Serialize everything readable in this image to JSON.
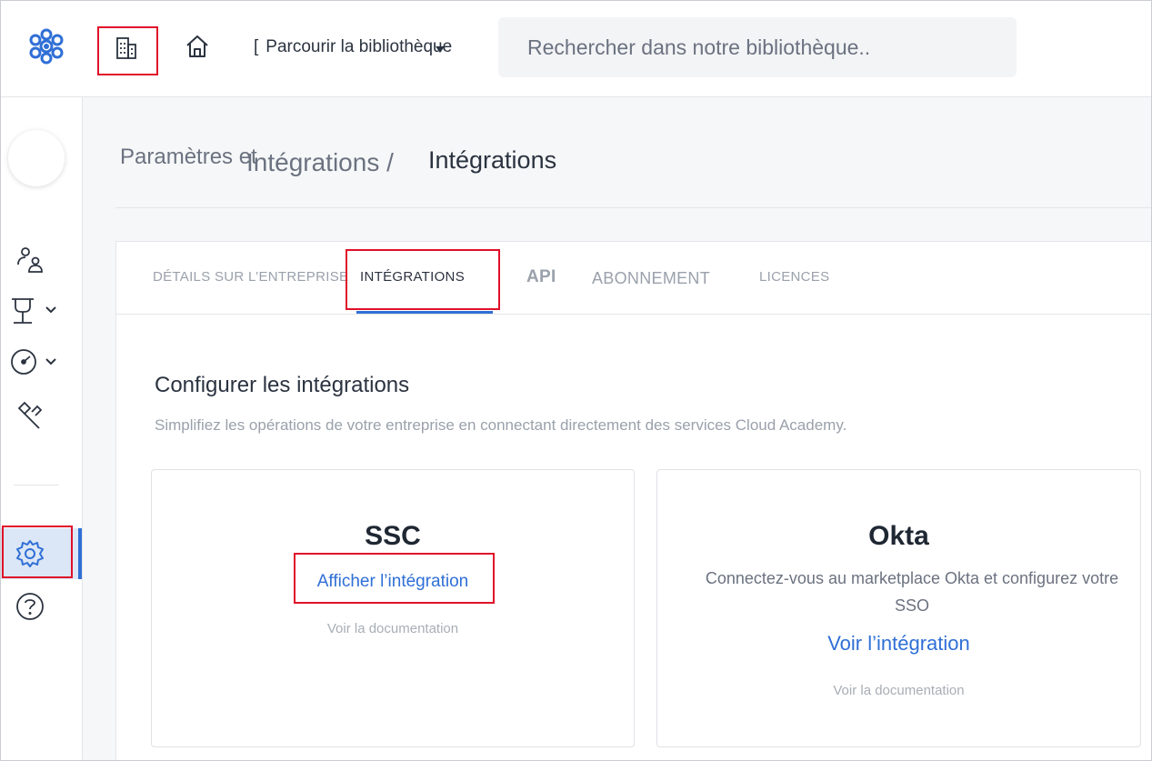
{
  "header": {
    "browse_label": "Parcourir la bibliothèque",
    "search_placeholder": "Rechercher dans notre bibliothèque.."
  },
  "breadcrumb": {
    "parent": "Paramètres et",
    "overlap": "Intégrations /",
    "current": "Intégrations"
  },
  "tabs": [
    {
      "label": "DÉTAILS  SUR  L’ENTREPRISE",
      "active": false
    },
    {
      "label": "INTÉGRATIONS",
      "active": true
    },
    {
      "label": "API",
      "active": false
    },
    {
      "label": "ABONNEMENT",
      "active": false
    },
    {
      "label": "LICENCES",
      "active": false
    }
  ],
  "section": {
    "title": "Configurer les intégrations",
    "subtitle": "Simplifiez les opérations de votre entreprise en connectant directement des services Cloud Academy."
  },
  "cards": {
    "ssc": {
      "title": "SSC",
      "link": "Afficher l’intégration",
      "doc": "Voir la documentation"
    },
    "okta": {
      "title": "Okta",
      "description": "Connectez-vous au marketplace Okta et configurez votre SSO",
      "link": "Voir l’intégration",
      "doc": "Voir la documentation"
    }
  },
  "colors": {
    "accent": "#2f6fd6",
    "highlight": "#e0102a",
    "text_dark": "#2b3340",
    "text_muted": "#9aa1ab"
  },
  "icons": [
    "logo-icon",
    "building-icon",
    "home-icon",
    "users-icon",
    "content-icon",
    "dashboard-icon",
    "tools-icon",
    "gear-icon",
    "help-icon"
  ]
}
